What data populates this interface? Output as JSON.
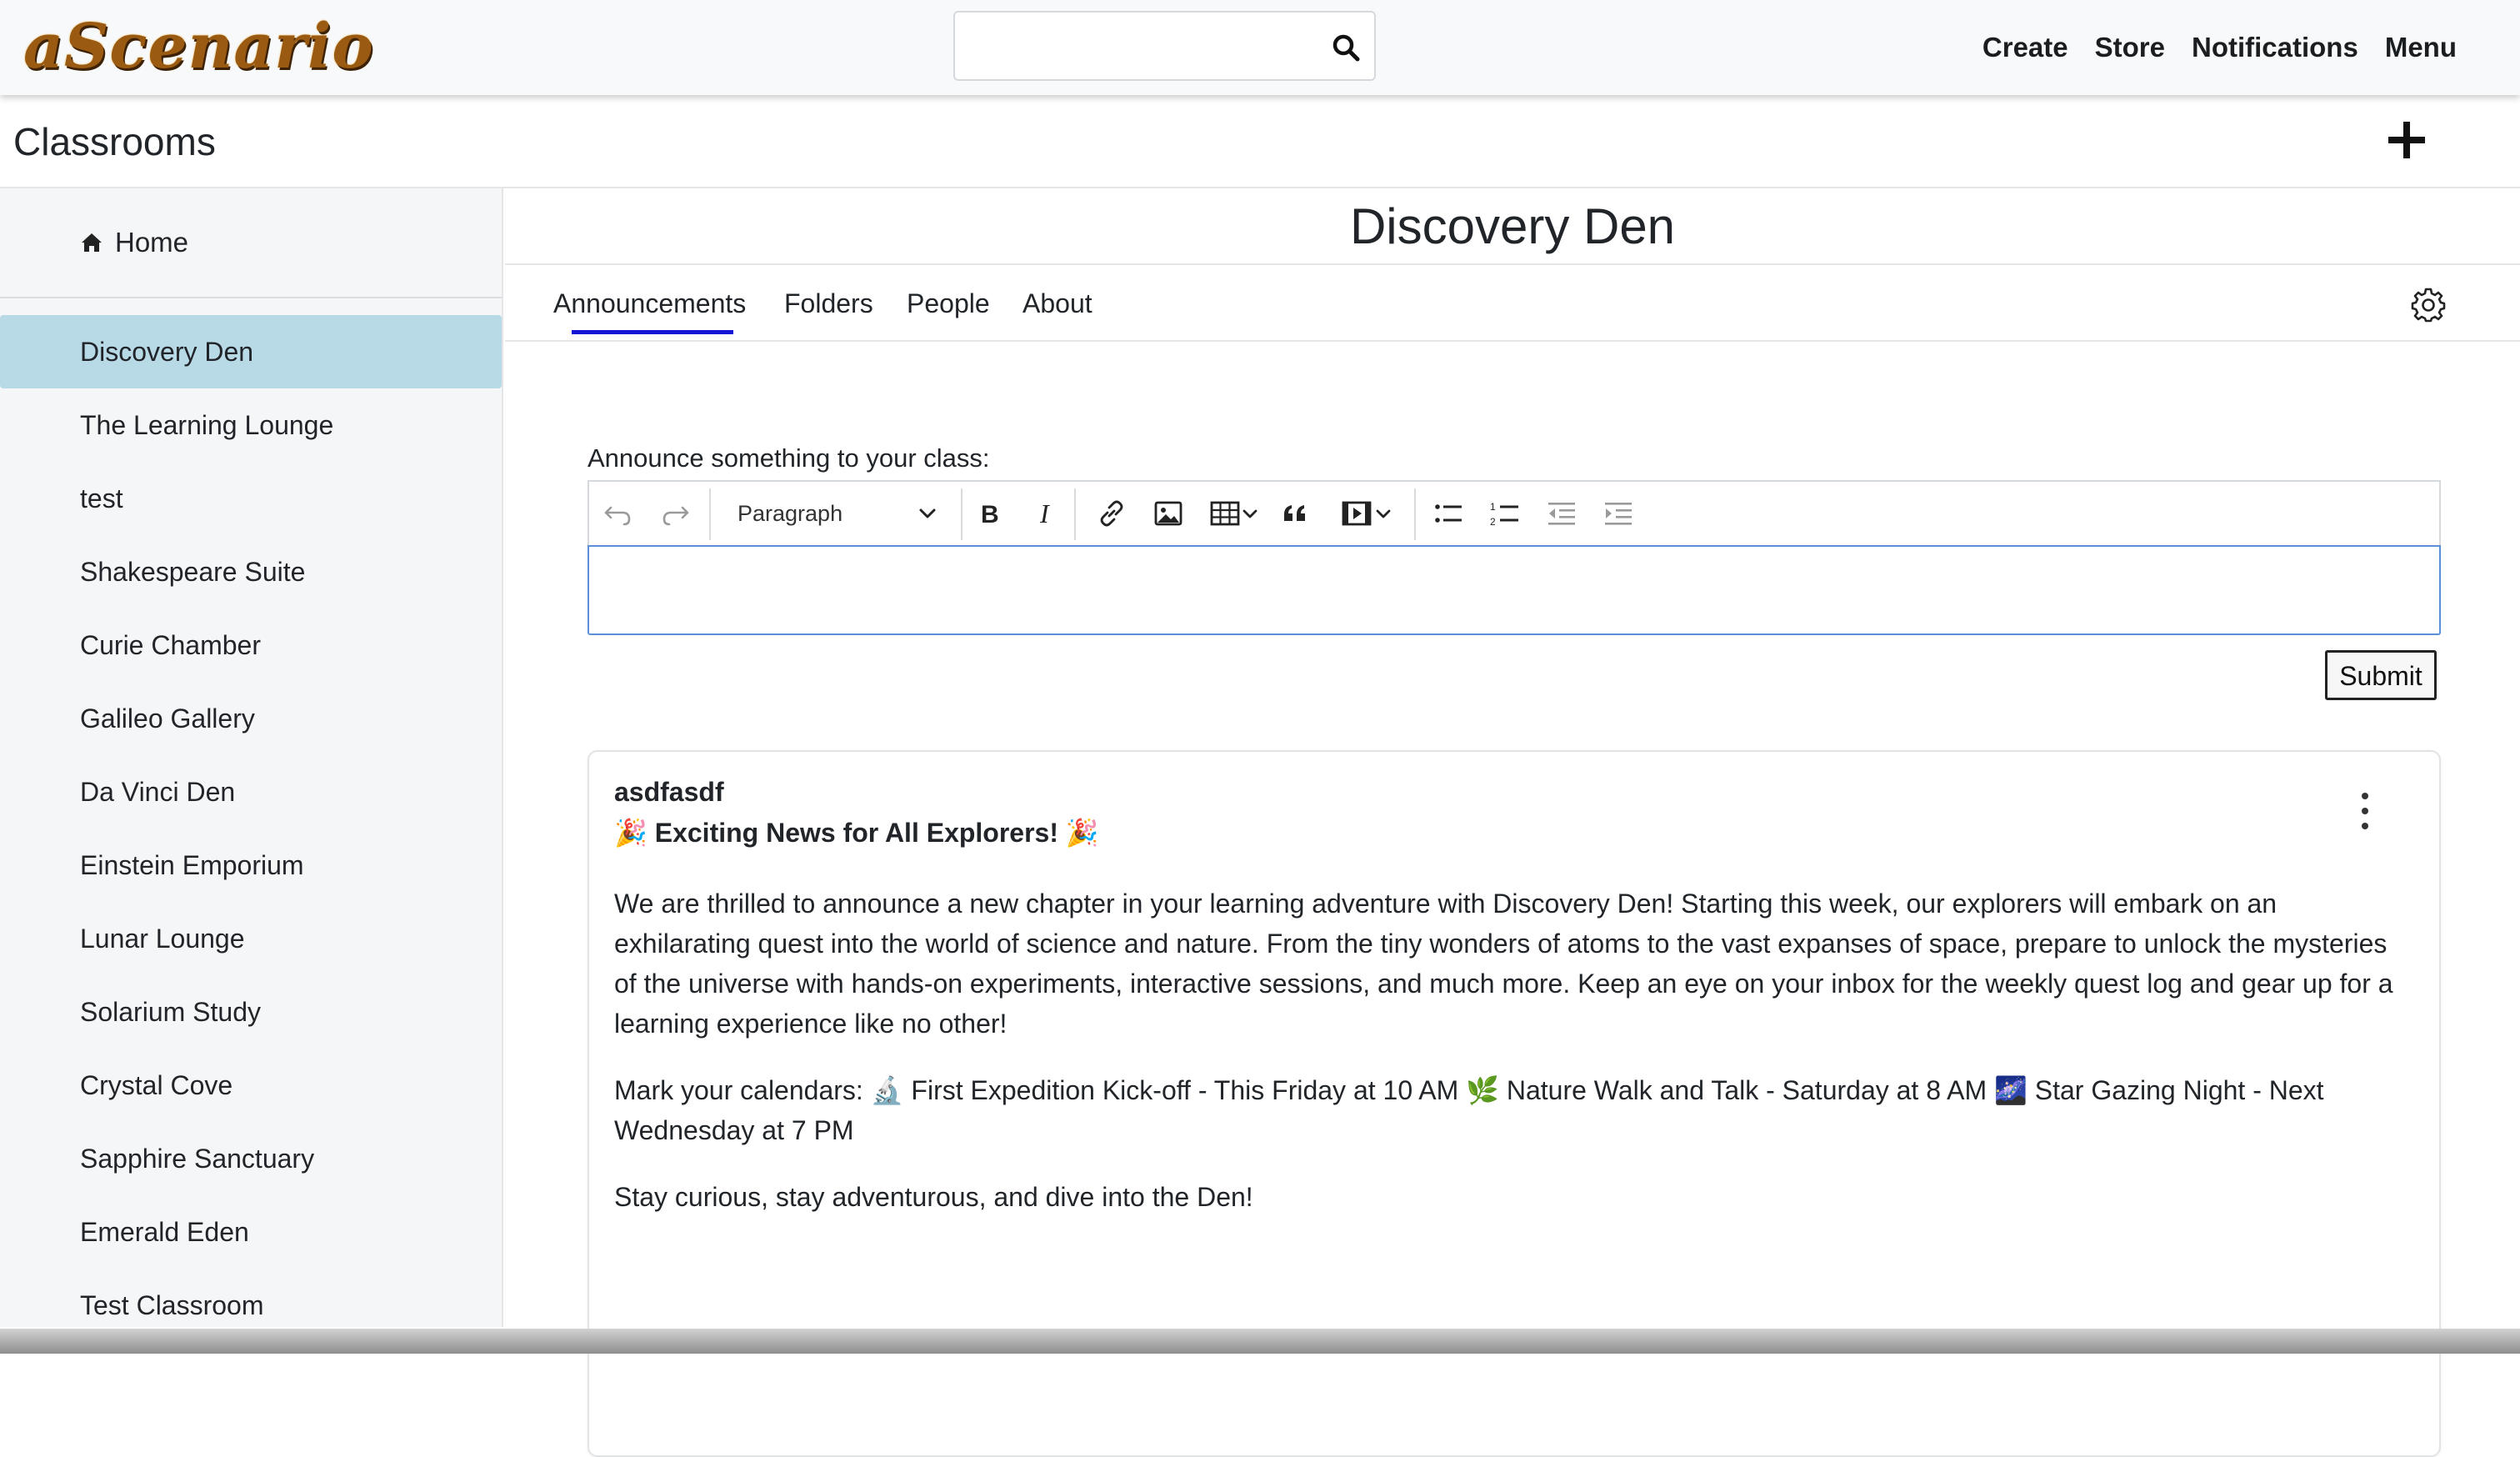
{
  "navbar": {
    "logo_text": "aScenario",
    "search": {
      "value": "",
      "placeholder": ""
    },
    "links": [
      "Create",
      "Store",
      "Notifications",
      "Menu"
    ]
  },
  "page": {
    "title": "Classrooms"
  },
  "sidebar": {
    "home_label": "Home",
    "classes": [
      "Discovery Den",
      "The Learning Lounge",
      "test",
      "Shakespeare Suite",
      "Curie Chamber",
      "Galileo Gallery",
      "Da Vinci Den",
      "Einstein Emporium",
      "Lunar Lounge",
      "Solarium Study",
      "Crystal Cove",
      "Sapphire Sanctuary",
      "Emerald Eden",
      "Test Classroom"
    ],
    "active_index": 0
  },
  "classroom": {
    "title": "Discovery Den",
    "tabs": [
      "Announcements",
      "Folders",
      "People",
      "About"
    ],
    "active_tab": "Announcements"
  },
  "composer": {
    "label": "Announce something to your class:",
    "block_style": "Paragraph",
    "content": "",
    "submit_label": "Submit"
  },
  "post": {
    "author": "asdfasdf",
    "headline": "🎉 Exciting News for All Explorers! 🎉",
    "paragraphs": [
      "We are thrilled to announce a new chapter in your learning adventure with Discovery Den! Starting this week, our explorers will embark on an exhilarating quest into the world of science and nature. From the tiny wonders of atoms to the vast expanses of space, prepare to unlock the mysteries of the universe with hands-on experiments, interactive sessions, and much more. Keep an eye on your inbox for the weekly quest log and gear up for a learning experience like no other!",
      "Mark your calendars: 🔬 First Expedition Kick-off - This Friday at 10 AM 🌿 Nature Walk and Talk - Saturday at 8 AM 🌌 Star Gazing Night - Next Wednesday at 7 PM",
      "Stay curious, stay adventurous, and dive into the Den!"
    ]
  },
  "colors": {
    "navbar_bg": "#f8f9fa",
    "active_class_bg": "#b8dae6",
    "tab_underline": "#1414d4",
    "editor_focus_border": "#5b90d6",
    "logo": "#9a5a12"
  },
  "icons": {
    "search": "search-icon",
    "add": "plus-icon",
    "home": "home-icon",
    "settings": "gear-icon",
    "post_menu": "more-vertical-icon"
  }
}
